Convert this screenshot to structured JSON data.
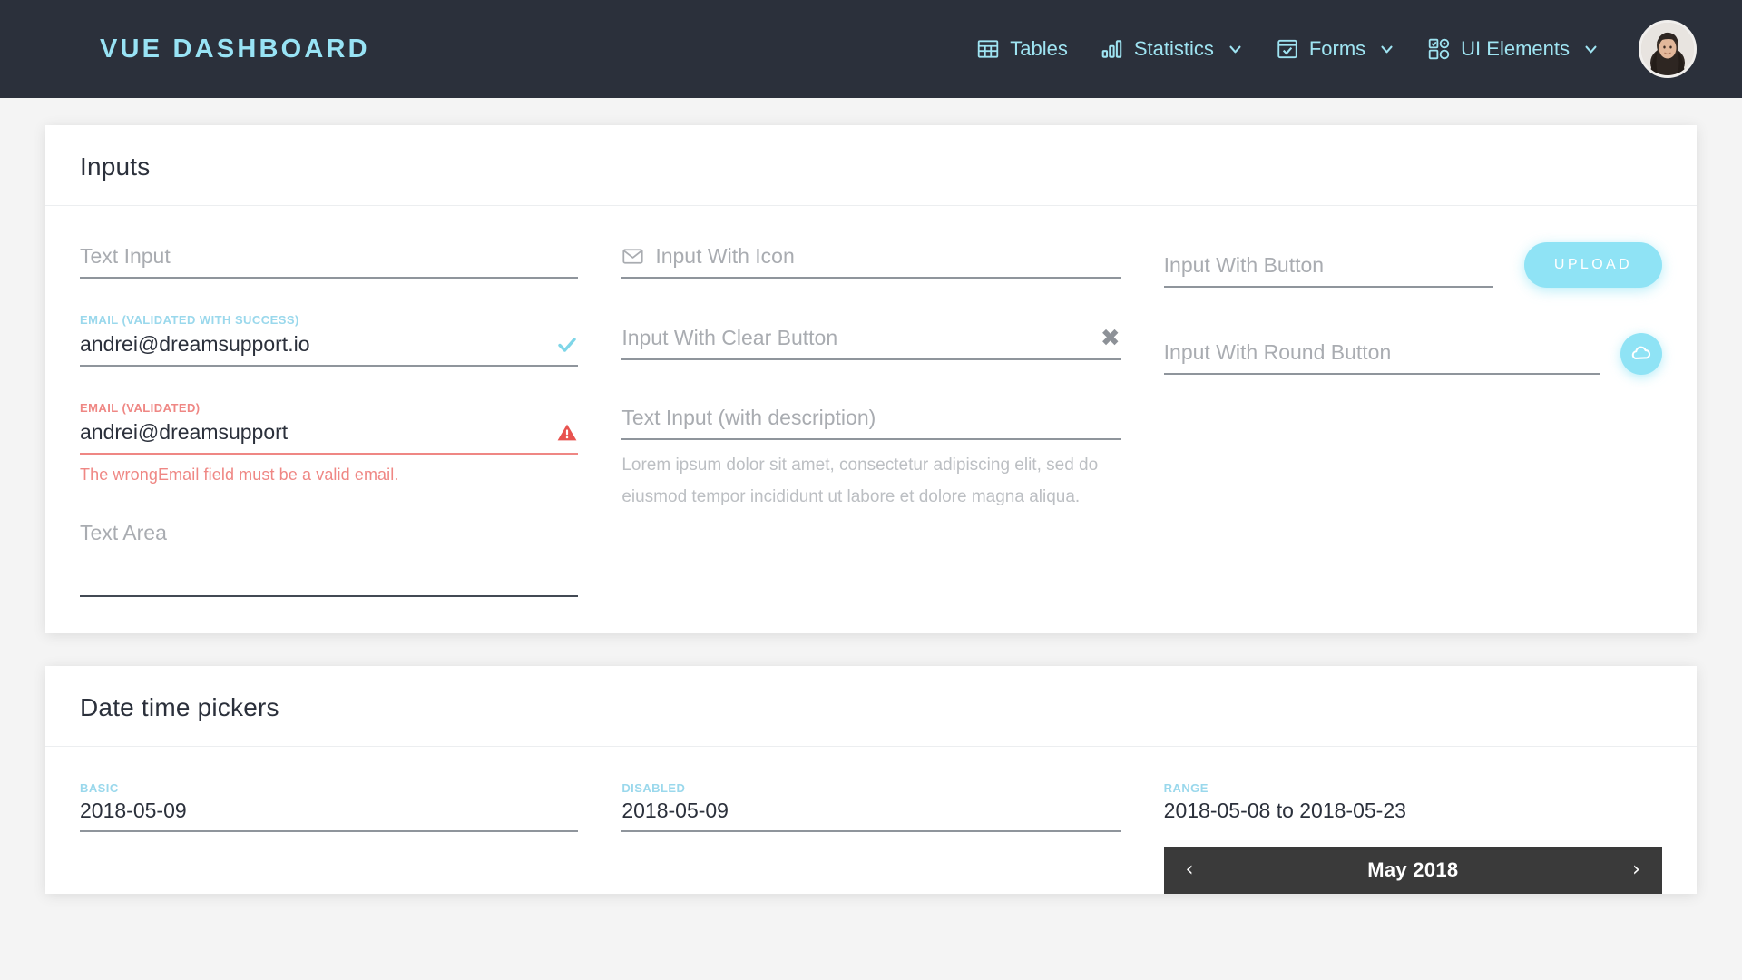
{
  "navbar": {
    "brand": "VUE DASHBOARD",
    "items": [
      {
        "label": "Tables",
        "icon": "table-icon",
        "caret": false
      },
      {
        "label": "Statistics",
        "icon": "bar-chart-icon",
        "caret": true
      },
      {
        "label": "Forms",
        "icon": "form-check-icon",
        "caret": true
      },
      {
        "label": "UI Elements",
        "icon": "ui-grid-icon",
        "caret": true
      }
    ],
    "avatar": "user-avatar"
  },
  "inputs_card": {
    "title": "Inputs",
    "col1": {
      "text_input": {
        "placeholder": "Text Input",
        "value": ""
      },
      "email_success": {
        "label": "EMAIL (VALIDATED WITH SUCCESS)",
        "value": "andrei@dreamsupport.io",
        "icon": "check-icon"
      },
      "email_error": {
        "label": "EMAIL (VALIDATED)",
        "value": "andrei@dreamsupport",
        "icon": "warning-triangle-icon",
        "error_message": "The wrongEmail field must be a valid email."
      },
      "text_area": {
        "placeholder": "Text Area",
        "value": ""
      }
    },
    "col2": {
      "input_with_icon": {
        "placeholder": "Input With Icon",
        "value": "",
        "icon": "envelope-icon"
      },
      "input_with_clear": {
        "placeholder": "Input With Clear Button",
        "value": "",
        "icon": "clear-x-icon"
      },
      "input_with_description": {
        "placeholder": "Text Input (with description)",
        "value": "",
        "description": "Lorem ipsum dolor sit amet, consectetur adipiscing elit, sed do eiusmod tempor incididunt ut labore et dolore magna aliqua."
      }
    },
    "col3": {
      "input_with_button": {
        "placeholder": "Input With Button",
        "value": "",
        "button_label": "UPLOAD"
      },
      "input_with_round_button": {
        "placeholder": "Input With Round Button",
        "value": "",
        "button_icon": "cloud-upload-icon"
      }
    }
  },
  "datetime_card": {
    "title": "Date time pickers",
    "basic": {
      "label": "BASIC",
      "value": "2018-05-09"
    },
    "disabled": {
      "label": "DISABLED",
      "value": "2018-05-09"
    },
    "range": {
      "label": "RANGE",
      "value": "2018-05-08 to 2018-05-23",
      "calendar": {
        "prev": "‹",
        "month": "May 2018",
        "next": "›"
      }
    }
  },
  "colors": {
    "nav_bg": "#2b303b",
    "accent": "#8fe3f5",
    "brand": "#98e3f5",
    "error": "#ef8784",
    "page_bg": "#f4f4f4",
    "calendar_header": "#3a3a3a"
  }
}
